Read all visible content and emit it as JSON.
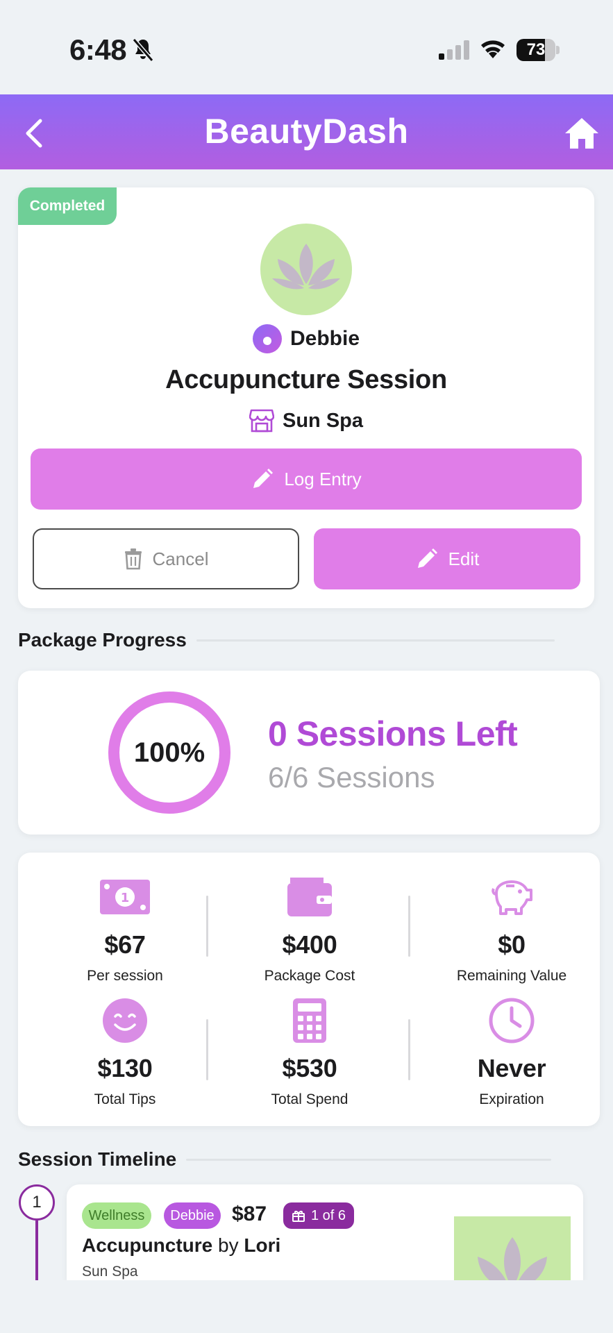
{
  "status_bar": {
    "time": "6:48",
    "battery": "73",
    "battery_level": 0.73
  },
  "header": {
    "title": "BeautyDash"
  },
  "booking": {
    "status": "Completed",
    "provider": "Debbie",
    "service": "Accupuncture Session",
    "location": "Sun Spa",
    "log_entry_label": "Log Entry",
    "cancel_label": "Cancel",
    "edit_label": "Edit"
  },
  "package_progress": {
    "section_title": "Package Progress",
    "percent": "100%",
    "percent_value": 1.0,
    "sessions_left": "0 Sessions Left",
    "sessions_count": "6/6 Sessions"
  },
  "stats": [
    {
      "icon": "money-icon",
      "value": "$67",
      "label": "Per session"
    },
    {
      "icon": "wallet-icon",
      "value": "$400",
      "label": "Package Cost"
    },
    {
      "icon": "piggy-bank-icon",
      "value": "$0",
      "label": "Remaining Value"
    },
    {
      "icon": "smile-icon",
      "value": "$130",
      "label": "Total Tips"
    },
    {
      "icon": "calculator-icon",
      "value": "$530",
      "label": "Total Spend"
    },
    {
      "icon": "clock-icon",
      "value": "Never",
      "label": "Expiration"
    }
  ],
  "timeline": {
    "section_title": "Session Timeline",
    "entries": [
      {
        "step": "1",
        "category": "Wellness",
        "provider": "Debbie",
        "price": "$87",
        "package": "1 of 6",
        "service": "Accupuncture",
        "by": "by",
        "staff": "Lori",
        "location": "Sun Spa"
      }
    ]
  },
  "colors": {
    "accent": "#e07de8",
    "accent_dark": "#b04ad6",
    "header_top": "#8d6af5",
    "completed": "#6fcf97",
    "avatar_bg": "#c7e9a6"
  }
}
